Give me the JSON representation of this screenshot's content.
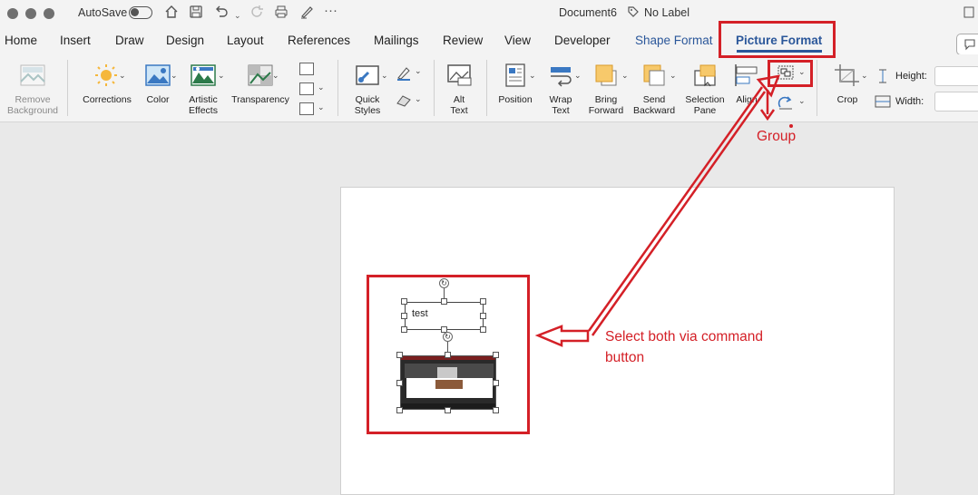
{
  "titlebar": {
    "autosave_label": "AutoSave",
    "document_title": "Document6",
    "sensitivity_label": "No Label",
    "icons": [
      "home-icon",
      "save-icon",
      "undo-icon",
      "redo-icon",
      "print-icon",
      "pen-icon",
      "more-icon"
    ]
  },
  "tabs": [
    "Home",
    "Insert",
    "Draw",
    "Design",
    "Layout",
    "References",
    "Mailings",
    "Review",
    "View",
    "Developer",
    "Shape Format",
    "Picture Format"
  ],
  "active_tab": "Picture Format",
  "ribbon": {
    "remove_background": [
      "Remove",
      "Background"
    ],
    "corrections": "Corrections",
    "color": "Color",
    "artistic_effects": [
      "Artistic",
      "Effects"
    ],
    "transparency": "Transparency",
    "quick_styles": [
      "Quick",
      "Styles"
    ],
    "alt_text": [
      "Alt",
      "Text"
    ],
    "position": "Position",
    "wrap_text": [
      "Wrap",
      "Text"
    ],
    "bring_forward": [
      "Bring",
      "Forward"
    ],
    "send_backward": [
      "Send",
      "Backward"
    ],
    "selection_pane": [
      "Selection",
      "Pane"
    ],
    "align": "Align",
    "crop": "Crop",
    "height_label": "Height:",
    "width_label": "Width:"
  },
  "document": {
    "textbox_text": "test"
  },
  "annotations": {
    "group_label": "Group",
    "select_note_line1": "Select both via command",
    "select_note_line2": "button",
    "color": "#d42027"
  }
}
